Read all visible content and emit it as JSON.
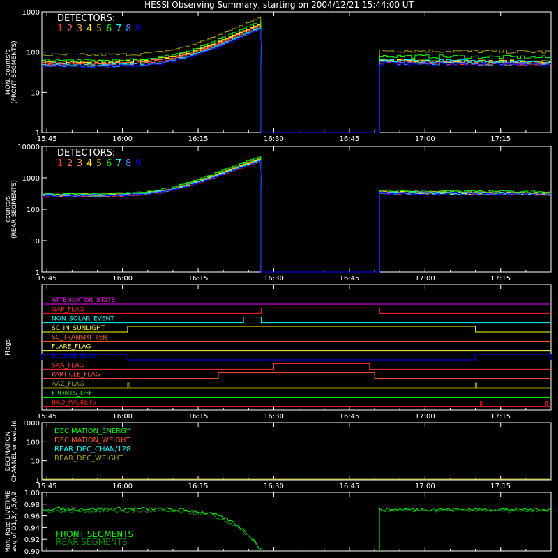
{
  "title": "HESSI Observing Summary, starting on 2004/12/21 15:44:00 UT",
  "x_ticks": [
    "15:45",
    "16:00",
    "16:15",
    "16:30",
    "16:45",
    "17:00",
    "17:15"
  ],
  "x_tick_minutes": [
    1,
    16,
    31,
    46,
    61,
    76,
    91
  ],
  "x_range_minutes": [
    0,
    101
  ],
  "detector_colors": [
    "#ff3030",
    "#ff6060",
    "#ffa040",
    "#ffff00",
    "#a0a000",
    "#00ff00",
    "#00ffff",
    "#4090ff",
    "#0000ff"
  ],
  "chart_data": [
    {
      "type": "line",
      "panel": "front",
      "ylabel_lines": [
        "MON. counts/s",
        "(FRONT SEGMENTS)"
      ],
      "y_scale": "log",
      "ylim": [
        1,
        1000
      ],
      "y_ticks": [
        "1",
        "10",
        "100",
        "1000"
      ],
      "legend_title": "DETECTORS:",
      "legend_placement": "top-left",
      "series": [
        {
          "name": "1",
          "color": "#ff3030",
          "base": 50,
          "peak": 450
        },
        {
          "name": "2",
          "color": "#ff6060",
          "base": 52,
          "peak": 480
        },
        {
          "name": "3",
          "color": "#ffa040",
          "base": 55,
          "peak": 500
        },
        {
          "name": "4",
          "color": "#ffff00",
          "base": 58,
          "peak": 520
        },
        {
          "name": "5",
          "color": "#a0a000",
          "base": 85,
          "peak": 750
        },
        {
          "name": "6",
          "color": "#00ff00",
          "base": 62,
          "peak": 600
        },
        {
          "name": "7",
          "color": "#00ffff",
          "base": 48,
          "peak": 420
        },
        {
          "name": "8",
          "color": "#4090ff",
          "base": 46,
          "peak": 400
        },
        {
          "name": "9",
          "color": "#0000ff",
          "base": 44,
          "peak": 380
        }
      ],
      "gap_minutes": [
        43.5,
        67
      ],
      "gap_level": 1,
      "after_levels": [
        55,
        58,
        60,
        62,
        110,
        80,
        62,
        55,
        52
      ]
    },
    {
      "type": "line",
      "panel": "rear",
      "ylabel_lines": [
        "counts/s",
        "(REAR SEGMENTS)"
      ],
      "y_scale": "log",
      "ylim": [
        1,
        10000
      ],
      "y_ticks": [
        "1",
        "10",
        "100",
        "1000",
        "10000"
      ],
      "legend_title": "DETECTORS:",
      "legend_placement": "top-left",
      "series": [
        {
          "name": "1",
          "color": "#ff3030",
          "base": 270,
          "peak": 3500
        },
        {
          "name": "2",
          "color": "#ff6060",
          "base": 275,
          "peak": 3800
        },
        {
          "name": "3",
          "color": "#ffa040",
          "base": 280,
          "peak": 4000
        },
        {
          "name": "4",
          "color": "#ffff00",
          "base": 290,
          "peak": 4200
        },
        {
          "name": "5",
          "color": "#a0a000",
          "base": 300,
          "peak": 4500
        },
        {
          "name": "6",
          "color": "#00ff00",
          "base": 310,
          "peak": 5000
        },
        {
          "name": "7",
          "color": "#00ffff",
          "base": 285,
          "peak": 3900
        },
        {
          "name": "8",
          "color": "#4090ff",
          "base": 280,
          "peak": 3700
        },
        {
          "name": "9",
          "color": "#0000ff",
          "base": 275,
          "peak": 3600
        }
      ],
      "gap_minutes": [
        43.5,
        67
      ],
      "gap_level": 1,
      "after_levels": [
        330,
        340,
        345,
        350,
        360,
        380,
        340,
        335,
        330
      ]
    },
    {
      "type": "line",
      "panel": "flags",
      "ylabel_lines": [
        "Flags"
      ],
      "flags": [
        {
          "label": "ATTENUATOR_STATE",
          "color": "#ff00ff",
          "steps": []
        },
        {
          "label": "GAP_FLAG",
          "color": "#ff2020",
          "steps": [
            [
              43.5,
              67
            ]
          ]
        },
        {
          "label": "NON_SOLAR_EVENT",
          "color": "#00ffff",
          "steps": [
            [
              40,
              43.5
            ]
          ]
        },
        {
          "label": "SC_IN_SUNLIGHT",
          "color": "#ffff00",
          "steps": [
            [
              17,
              86
            ]
          ]
        },
        {
          "label": "SC_TRANSMITTER",
          "color": "#ff6020",
          "steps": []
        },
        {
          "label": "FLARE_FLAG",
          "color": "#ffff40",
          "steps": []
        },
        {
          "label": "ECLIPSE_FLAG",
          "color": "#0000ff",
          "steps": [
            [
              0,
              17
            ],
            [
              86,
              101
            ]
          ]
        },
        {
          "label": "SAA_FLAG",
          "color": "#ff3030",
          "steps": [
            [
              46,
              65
            ]
          ]
        },
        {
          "label": "PARTICLE_FLAG",
          "color": "#ff5030",
          "steps": [
            [
              35,
              66
            ]
          ]
        },
        {
          "label": "AAZ_FLAG",
          "color": "#a0a000",
          "spikes": [
            17,
            86
          ]
        },
        {
          "label": "FRONTS_OFF",
          "color": "#00ff00",
          "steps": []
        },
        {
          "label": "BAD_PACKETS",
          "color": "#ff2020",
          "spikes": [
            87,
            100
          ]
        }
      ]
    },
    {
      "type": "line",
      "panel": "decimation",
      "ylabel_lines": [
        "DECIMATION",
        "CHANNEL or weight"
      ],
      "y_scale": "log",
      "ylim": [
        1,
        1000
      ],
      "y_ticks": [
        "1",
        "10",
        "100",
        "1000"
      ],
      "legend_placement": "top-left",
      "series": [
        {
          "name": "DECIMATION_ENERGY",
          "color": "#00ff00"
        },
        {
          "name": "DECIMATION_WEIGHT",
          "color": "#ff5030"
        },
        {
          "name": "REAR_DEC_CHAN/128",
          "color": "#00ffff"
        },
        {
          "name": "REAR_DEC_WEIGHT",
          "color": "#a0a000"
        }
      ]
    },
    {
      "type": "line",
      "panel": "livetime",
      "ylabel_lines": [
        "Mon. Rate LIVETIME",
        "avg of D1,3,4,5,6,9"
      ],
      "ylim": [
        0.9,
        1.0
      ],
      "y_ticks": [
        "0.90",
        "0.92",
        "0.94",
        "0.96",
        "0.98",
        "1.00"
      ],
      "legend_placement": "bottom-left",
      "series": [
        {
          "name": "FRONT SEGMENTS",
          "color": "#00ff00",
          "base": 0.972
        },
        {
          "name": "REAR SEGMENTS",
          "color": "#009000",
          "base": 0.97
        }
      ],
      "gap_minutes": [
        43.5,
        67
      ]
    }
  ]
}
